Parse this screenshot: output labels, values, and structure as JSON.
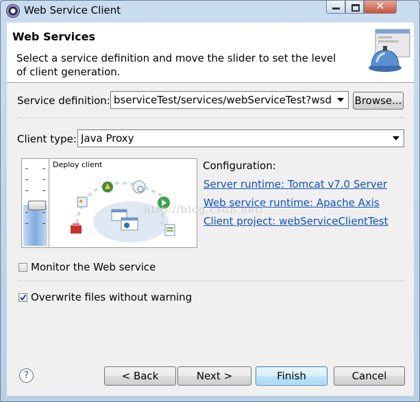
{
  "window": {
    "title": "Web Service Client",
    "close_glyph": "✕"
  },
  "header": {
    "title": "Web Services",
    "description": "Select a service definition and move the slider to set the level of client generation.",
    "icon": "bell-icon"
  },
  "form": {
    "service_definition_label": "Service definition:",
    "service_definition_value": "bserviceTest/services/webServiceTest?wsdl",
    "browse_label": "Browse...",
    "client_type_label": "Client type:",
    "client_type_value": "Java Proxy"
  },
  "slider": {
    "stage_label": "Deploy client",
    "level": 0.48
  },
  "configuration": {
    "title": "Configuration:",
    "server_runtime": "Server runtime: Tomcat v7.0 Server",
    "web_service_runtime": "Web service runtime: Apache Axis",
    "client_project": "Client project: webServiceClientTest"
  },
  "options": {
    "monitor_label": "Monitor the Web service",
    "monitor_checked": false,
    "overwrite_label": "Overwrite files without warning",
    "overwrite_checked": true
  },
  "watermark": "http://blog.csdn.net/",
  "footer": {
    "help_glyph": "?",
    "back_label": "< Back",
    "next_label": "Next >",
    "finish_label": "Finish",
    "cancel_label": "Cancel"
  },
  "colors": {
    "link": "#0a4fc4",
    "finish_border": "#3c7fb1",
    "frame": "#bcd3ea"
  }
}
